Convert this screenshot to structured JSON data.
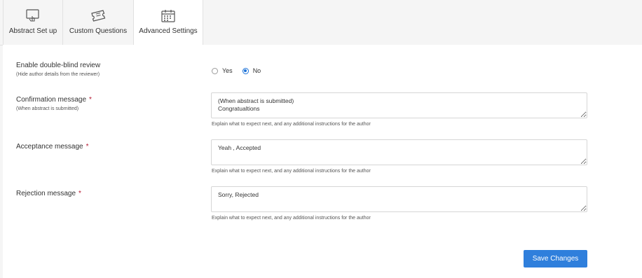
{
  "tabs": [
    {
      "label": "Abstract Set up",
      "icon": "monitor-hand-icon",
      "active": false
    },
    {
      "label": "Custom Questions",
      "icon": "ticket-icon",
      "active": false
    },
    {
      "label": "Advanced Settings",
      "icon": "calendar-icon",
      "active": true
    }
  ],
  "double_blind": {
    "label": "Enable double-blind review",
    "sublabel": "(Hide author details from the reviewer)",
    "options": [
      "Yes",
      "No"
    ],
    "selected": "No"
  },
  "confirmation": {
    "label": "Confirmation message",
    "required_mark": "*",
    "sublabel": "(When abstract is submitted)",
    "value": "(When abstract is submitted)\nCongratualtions",
    "help": "Explain what to expect next, and any additional instructions for the author"
  },
  "acceptance": {
    "label": "Acceptance message",
    "required_mark": "*",
    "value": "Yeah , Accepted",
    "help": "Explain what to expect next, and any additional instructions for the author"
  },
  "rejection": {
    "label": "Rejection message",
    "required_mark": "*",
    "value": "Sorry, Rejected",
    "help": "Explain what to expect next, and any additional instructions for the author"
  },
  "save_label": "Save Changes",
  "colors": {
    "accent": "#2f7fdc",
    "required": "#b3172f",
    "radio": "#1e73d8"
  }
}
